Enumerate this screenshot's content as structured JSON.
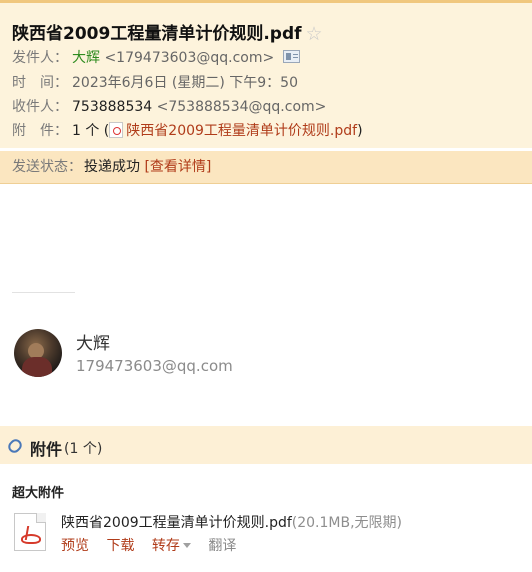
{
  "mail": {
    "subject": "陕西省2009工程量清单计价规则.pdf",
    "star_icon": "star-icon",
    "from_label": "发件人：",
    "from_name": "大辉",
    "from_addr": "<179473603@qq.com>",
    "time_label": "时　间：",
    "time_value": "2023年6月6日 (星期二) 下午9：50",
    "to_label": "收件人：",
    "to_name": "753888534",
    "to_addr": "<753888534@qq.com>",
    "attach_label": "附　件：",
    "attach_prefix": "1 个 (",
    "attach_name": "陕西省2009工程量清单计价规则.pdf",
    "attach_suffix": ")"
  },
  "status": {
    "label": "发送状态：",
    "value": "投递成功",
    "detail_link": "[查看详情]"
  },
  "card": {
    "name": "大辉",
    "email": "179473603@qq.com"
  },
  "attachments": {
    "title": "附件",
    "count": "(1 个)",
    "section_label": "超大附件",
    "file_name": "陕西省2009工程量清单计价规则.pdf",
    "file_meta": "(20.1MB,无限期)",
    "actions": {
      "preview": "预览",
      "download": "下载",
      "save": "转存",
      "translate": "翻译"
    }
  },
  "colors": {
    "header_bg": "#fdf3dc",
    "status_bg": "#fbe6c0",
    "link": "#b03c1a",
    "sender": "#2e8b1f"
  }
}
